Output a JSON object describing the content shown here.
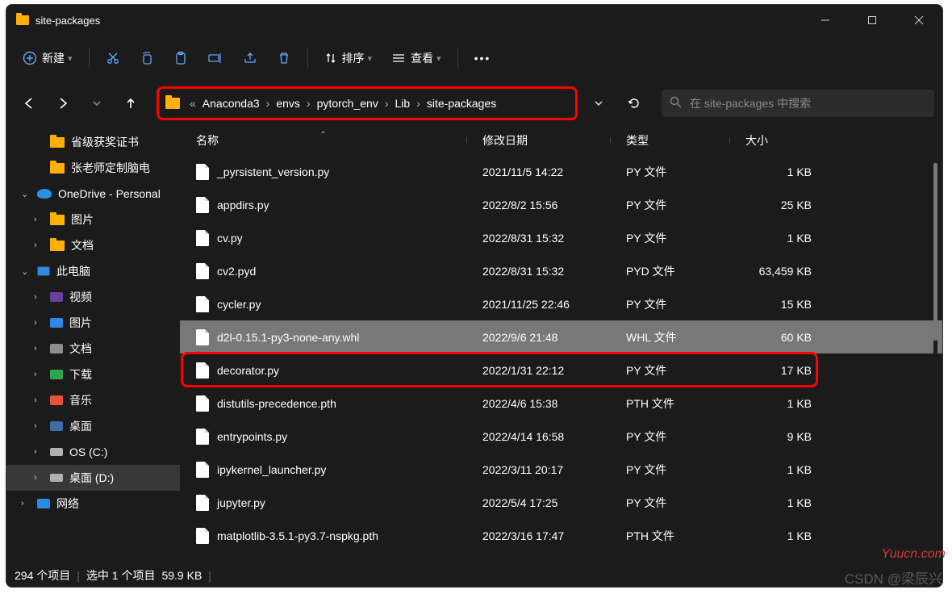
{
  "window": {
    "title": "site-packages"
  },
  "toolbar": {
    "new": "新建",
    "sort": "排序",
    "view": "查看"
  },
  "breadcrumb": {
    "more": "«",
    "items": [
      "Anaconda3",
      "envs",
      "pytorch_env",
      "Lib",
      "site-packages"
    ]
  },
  "search": {
    "placeholder": "在 site-packages 中搜索"
  },
  "tree": {
    "items": [
      {
        "kind": "yfold",
        "depth": 1,
        "label": "省级获奖证书"
      },
      {
        "kind": "yfold",
        "depth": 1,
        "label": "张老师定制脑电"
      },
      {
        "kind": "onedrive",
        "depth": 0,
        "chev": "v",
        "label": "OneDrive - Personal"
      },
      {
        "kind": "yfold",
        "depth": 1,
        "chev": ">",
        "label": "图片"
      },
      {
        "kind": "yfold",
        "depth": 1,
        "chev": ">",
        "label": "文档"
      },
      {
        "kind": "pc",
        "depth": 0,
        "chev": "v",
        "label": "此电脑"
      },
      {
        "kind": "special",
        "depth": 1,
        "chev": ">",
        "label": "视频",
        "c": "#6b3fa0"
      },
      {
        "kind": "special",
        "depth": 1,
        "chev": ">",
        "label": "图片",
        "c": "#2a8ae8"
      },
      {
        "kind": "special",
        "depth": 1,
        "chev": ">",
        "label": "文档",
        "c": "#8e8e8e"
      },
      {
        "kind": "special",
        "depth": 1,
        "chev": ">",
        "label": "下载",
        "c": "#2fa64d"
      },
      {
        "kind": "special",
        "depth": 1,
        "chev": ">",
        "label": "音乐",
        "c": "#e2553c"
      },
      {
        "kind": "special",
        "depth": 1,
        "chev": ">",
        "label": "桌面",
        "c": "#3a6ea5"
      },
      {
        "kind": "drive",
        "depth": 1,
        "chev": ">",
        "label": "OS (C:)"
      },
      {
        "kind": "drive",
        "depth": 1,
        "chev": ">",
        "label": "桌面 (D:)",
        "sel": true
      },
      {
        "kind": "special",
        "depth": 0,
        "chev": ">",
        "label": "网络",
        "c": "#2a8ae8"
      }
    ]
  },
  "columns": {
    "name": "名称",
    "date": "修改日期",
    "type": "类型",
    "size": "大小"
  },
  "files": [
    {
      "n": "_pyrsistent_version.py",
      "d": "2021/11/5 14:22",
      "t": "PY 文件",
      "s": "1 KB"
    },
    {
      "n": "appdirs.py",
      "d": "2022/8/2 15:56",
      "t": "PY 文件",
      "s": "25 KB"
    },
    {
      "n": "cv.py",
      "d": "2022/8/31 15:32",
      "t": "PY 文件",
      "s": "1 KB"
    },
    {
      "n": "cv2.pyd",
      "d": "2022/8/31 15:32",
      "t": "PYD 文件",
      "s": "63,459 KB"
    },
    {
      "n": "cycler.py",
      "d": "2021/11/25 22:46",
      "t": "PY 文件",
      "s": "15 KB"
    },
    {
      "n": "d2l-0.15.1-py3-none-any.whl",
      "d": "2022/9/6 21:48",
      "t": "WHL 文件",
      "s": "60 KB",
      "sel": true
    },
    {
      "n": "decorator.py",
      "d": "2022/1/31 22:12",
      "t": "PY 文件",
      "s": "17 KB"
    },
    {
      "n": "distutils-precedence.pth",
      "d": "2022/4/6 15:38",
      "t": "PTH 文件",
      "s": "1 KB"
    },
    {
      "n": "entrypoints.py",
      "d": "2022/4/14 16:58",
      "t": "PY 文件",
      "s": "9 KB"
    },
    {
      "n": "ipykernel_launcher.py",
      "d": "2022/3/11 20:17",
      "t": "PY 文件",
      "s": "1 KB"
    },
    {
      "n": "jupyter.py",
      "d": "2022/5/4 17:25",
      "t": "PY 文件",
      "s": "1 KB"
    },
    {
      "n": "matplotlib-3.5.1-py3.7-nspkg.pth",
      "d": "2022/3/16 17:47",
      "t": "PTH 文件",
      "s": "1 KB"
    }
  ],
  "status": {
    "count": "294 个项目",
    "selection": "选中 1 个项目",
    "size": "59.9 KB"
  },
  "watermarks": {
    "csdn": "CSDN @梁辰兴",
    "yuucn": "Yuucn.com"
  }
}
